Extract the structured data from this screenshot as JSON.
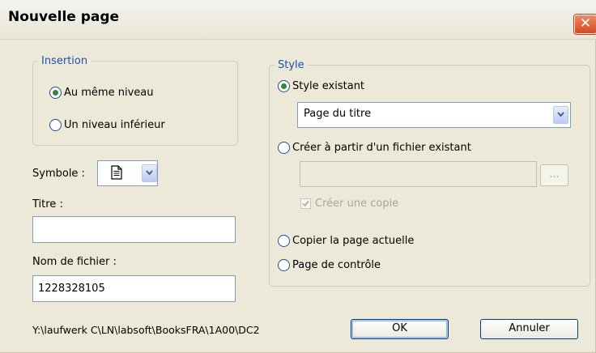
{
  "window": {
    "title": "Nouvelle page",
    "close_glyph": "✕"
  },
  "insertion": {
    "legend": "Insertion",
    "options": [
      {
        "label": "Au même niveau",
        "selected": true
      },
      {
        "label": "Un niveau inférieur",
        "selected": false
      }
    ]
  },
  "symbol": {
    "label": "Symbole :",
    "icon": "page-icon"
  },
  "title_field": {
    "label": "Titre :",
    "value": ""
  },
  "filename_field": {
    "label": "Nom de fichier :",
    "value": "1228328105"
  },
  "path": "Y:\\laufwerk C\\LN\\labsoft\\BooksFRA\\1A00\\DC2",
  "style": {
    "legend": "Style",
    "existing": {
      "label": "Style existant",
      "selected": true,
      "value": "Page du titre"
    },
    "from_file": {
      "label": "Créer à partir d'un fichier existant",
      "selected": false,
      "value": "",
      "browse_label": "...",
      "copy_label": "Créer une copie",
      "copy_checked": true
    },
    "copy_current": {
      "label": "Copier la page actuelle",
      "selected": false
    },
    "control_page": {
      "label": "Page de contrôle",
      "selected": false
    }
  },
  "buttons": {
    "ok": "OK",
    "cancel": "Annuler"
  },
  "colors": {
    "accent_blue": "#1e50b4",
    "radio_selected": "#2f8a2f",
    "close_red": "#d44a1e",
    "dialog_bg": "#ece9d8"
  }
}
